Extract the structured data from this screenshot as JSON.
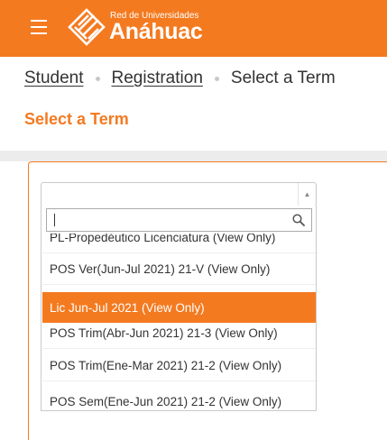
{
  "header": {
    "logo_small": "Red de Universidades",
    "logo_big": "Anáhuac",
    "brand_color": "#f47a20"
  },
  "breadcrumb": {
    "items": [
      "Student",
      "Registration"
    ],
    "current": "Select a Term"
  },
  "page_title": "Select a Term",
  "term_select": {
    "value": "",
    "search_value": "",
    "options": [
      "PL-Propedéutico Licenciatura (View Only)",
      "POS Ver(Jun-Jul 2021) 21-V (View Only)",
      "Lic Jun-Jul 2021 (View Only)",
      "POS Trim(Abr-Jun 2021) 21-3 (View Only)",
      "POS Trim(Ene-Mar 2021) 21-2 (View Only)",
      "POS Sem(Ene-Jun 2021) 21-2 (View Only)"
    ],
    "highlighted_option": "Lic Jun-Jul 2021 (View Only)"
  }
}
